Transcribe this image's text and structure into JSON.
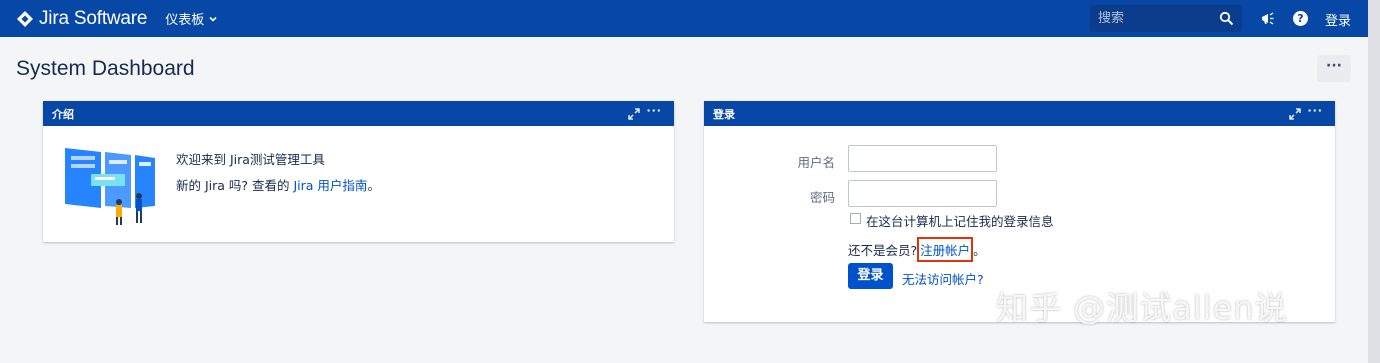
{
  "topbar": {
    "app_name": "Jira Software",
    "dashboards_label": "仪表板",
    "search_placeholder": "搜索",
    "help_glyph": "?",
    "login_label": "登录",
    "bg_color": "#0747a6"
  },
  "page": {
    "title": "System Dashboard",
    "more_label": "···"
  },
  "intro_gadget": {
    "title": "介绍",
    "welcome": "欢迎来到 Jira测试管理工具",
    "new_prefix": "新的 Jira 吗? 查看的 ",
    "guide_link": "Jira 用户指南",
    "new_suffix": "。",
    "menu_label": "···"
  },
  "login_gadget": {
    "title": "登录",
    "username_label": "用户名",
    "password_label": "密码",
    "remember_label": "在这台计算机上记住我的登录信息",
    "not_member_prefix": "还不是会员?",
    "register_link": "注册帐户",
    "not_member_suffix": "。",
    "login_button": "登录",
    "cant_access": "无法访问帐户?",
    "menu_label": "···"
  },
  "watermark": "知乎 @测试allen说"
}
